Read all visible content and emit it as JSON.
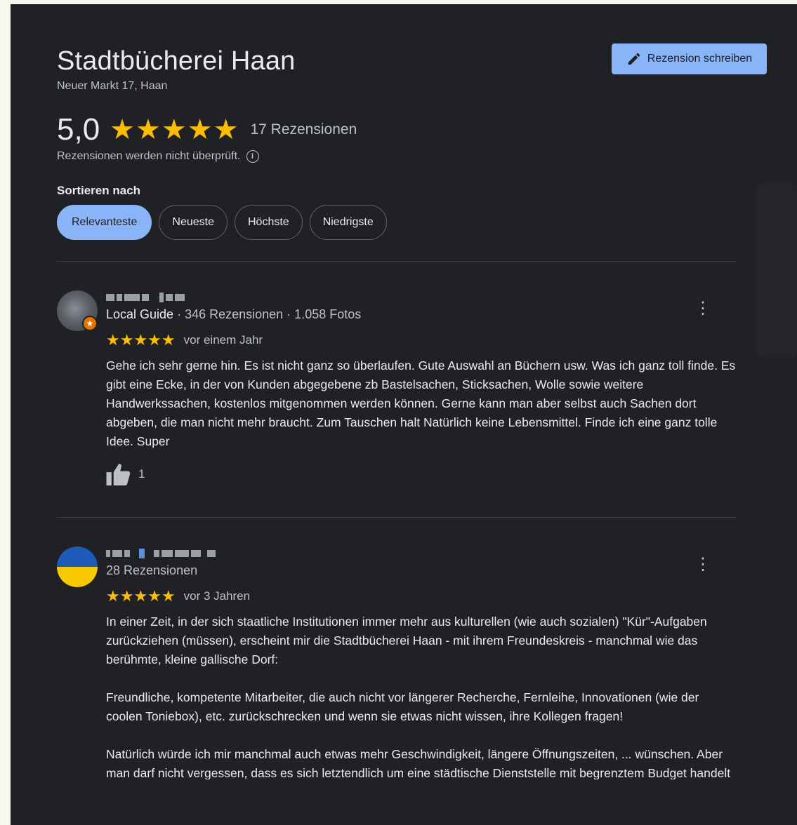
{
  "place": {
    "title": "Stadtbücherei Haan",
    "address": "Neuer Markt 17, Haan"
  },
  "write_review_label": "Rezension schreiben",
  "rating": {
    "value": "5,0",
    "stars_display": "★★★★★",
    "count_label": "17 Rezensionen",
    "disclaimer": "Rezensionen werden nicht überprüft."
  },
  "sort": {
    "label": "Sortieren nach",
    "options": [
      "Relevanteste",
      "Neueste",
      "Höchste",
      "Niedrigste"
    ],
    "selected": "Relevanteste"
  },
  "reviews": [
    {
      "local_guide_label": "Local Guide",
      "meta_rest": " · 346 Rezensionen · 1.058 Fotos",
      "stars_display": "★★★★★",
      "time": "vor einem Jahr",
      "paragraphs": [
        "Gehe ich sehr gerne hin. Es ist nicht ganz so überlaufen. Gute Auswahl an Büchern usw. Was ich ganz toll finde. Es gibt eine Ecke, in der von Kunden abgegebene zb Bastelsachen, Sticksachen, Wolle sowie weitere Handwerkssachen, kostenlos mitgenommen werden können. Gerne kann man aber selbst auch Sachen dort abgeben, die man nicht mehr braucht. Zum Tauschen halt Natürlich keine Lebensmittel. Finde ich eine ganz tolle Idee. Super"
      ],
      "likes": "1"
    },
    {
      "meta": "28 Rezensionen",
      "stars_display": "★★★★★",
      "time": "vor 3 Jahren",
      "paragraphs": [
        "In einer Zeit, in der sich staatliche Institutionen immer mehr aus kulturellen (wie auch sozialen) \"Kür\"-Aufgaben zurückziehen (müssen), erscheint mir die Stadtbücherei Haan - mit ihrem Freundeskreis - manchmal wie das berühmte, kleine gallische Dorf:",
        "Freundliche, kompetente Mitarbeiter, die auch nicht vor längerer Recherche, Fernleihe, Innovationen (wie der coolen Toniebox), etc. zurückschrecken und wenn sie etwas nicht wissen, ihre Kollegen fragen!",
        "Natürlich würde ich mir manchmal auch etwas mehr Geschwindigkeit, längere Öffnungszeiten, ... wünschen. Aber man darf nicht vergessen, dass es sich letztendlich um eine städtische Dienststelle mit begrenztem Budget handelt und dafür wird hier ein \"guter Job\" gemacht."
      ]
    }
  ],
  "colors": {
    "panel_bg": "#202124",
    "accent_blue": "#8ab4f8",
    "star_yellow": "#fbbc04"
  }
}
